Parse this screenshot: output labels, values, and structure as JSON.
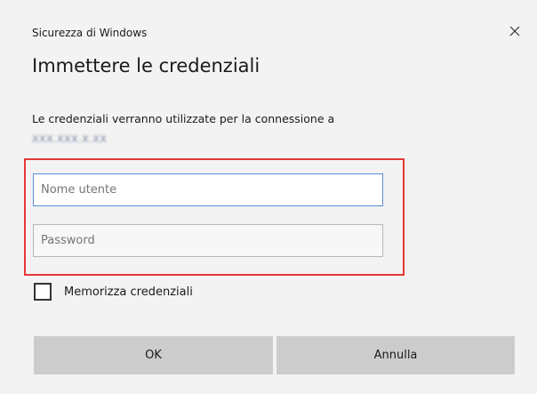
{
  "window": {
    "title": "Sicurezza di Windows",
    "close_icon": "close-icon"
  },
  "dialog": {
    "heading": "Immettere le credenziali",
    "description": "Le credenziali verranno utilizzate per la connessione a",
    "host": "XXX.XXX.X.XX"
  },
  "form": {
    "username_placeholder": "Nome utente",
    "password_placeholder": "Password",
    "remember_label": "Memorizza credenziali",
    "remember_checked": false
  },
  "buttons": {
    "ok_label": "OK",
    "cancel_label": "Annulla"
  },
  "colors": {
    "highlight": "#e53935",
    "focus_border": "#5b8fd6",
    "button_bg": "#cccccc"
  }
}
